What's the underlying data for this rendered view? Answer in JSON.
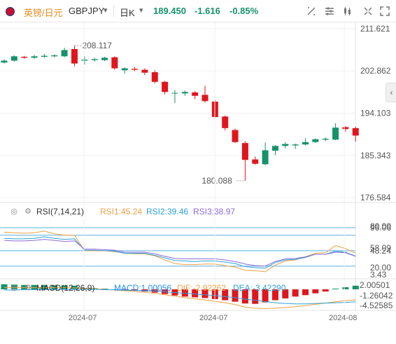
{
  "header": {
    "symbol_cn": "英镑/日元",
    "symbol_code": "GBPJPY",
    "period": "日K",
    "price": "189.450",
    "change": "-1.616",
    "change_pct": "-0.85%"
  },
  "colors": {
    "up": "#16926b",
    "down": "#e0161d",
    "rsi1": "#f0a045",
    "rsi2": "#2fa0d8",
    "rsi3": "#8a6bd8",
    "macd": "#1e90ff",
    "dif": "#f0a045",
    "dea": "#2fa0d8"
  },
  "chart_data": [
    {
      "type": "candlestick",
      "price_axis_labels": [
        "211.621",
        "202.862",
        "194.103",
        "185.343",
        "176.584"
      ],
      "ylim": [
        176.584,
        211.621
      ],
      "time_axis_labels": [
        "2024-07",
        "2024-07",
        "2024-08"
      ],
      "annotations": {
        "high_label": "208.117",
        "low_label": "180.088"
      },
      "candles": [
        {
          "o": 204.6,
          "h": 205.3,
          "c": 205.0,
          "l": 204.4
        },
        {
          "o": 205.0,
          "h": 206.1,
          "c": 205.9,
          "l": 204.8
        },
        {
          "o": 205.8,
          "h": 206.0,
          "c": 205.6,
          "l": 205.4
        },
        {
          "o": 205.6,
          "h": 206.2,
          "c": 205.9,
          "l": 205.4
        },
        {
          "o": 205.8,
          "h": 206.4,
          "c": 206.0,
          "l": 205.6
        },
        {
          "o": 205.9,
          "h": 206.3,
          "c": 206.1,
          "l": 205.7
        },
        {
          "o": 205.9,
          "h": 207.7,
          "c": 207.2,
          "l": 205.7
        },
        {
          "o": 207.4,
          "h": 208.117,
          "c": 204.4,
          "l": 203.8
        },
        {
          "o": 205.0,
          "h": 205.9,
          "c": 205.2,
          "l": 204.2
        },
        {
          "o": 205.1,
          "h": 205.6,
          "c": 205.3,
          "l": 204.8
        },
        {
          "o": 205.1,
          "h": 205.8,
          "c": 205.6,
          "l": 204.9
        },
        {
          "o": 205.7,
          "h": 205.9,
          "c": 203.4,
          "l": 203.1
        },
        {
          "o": 203.0,
          "h": 203.6,
          "c": 203.4,
          "l": 202.3
        },
        {
          "o": 203.3,
          "h": 203.7,
          "c": 203.1,
          "l": 202.8
        },
        {
          "o": 203.1,
          "h": 203.4,
          "c": 202.5,
          "l": 202.0
        },
        {
          "o": 202.6,
          "h": 203.0,
          "c": 200.6,
          "l": 200.3
        },
        {
          "o": 200.6,
          "h": 200.8,
          "c": 198.5,
          "l": 198.0
        },
        {
          "o": 198.2,
          "h": 198.9,
          "c": 198.3,
          "l": 196.2
        },
        {
          "o": 198.2,
          "h": 198.8,
          "c": 198.5,
          "l": 197.7
        },
        {
          "o": 198.4,
          "h": 198.7,
          "c": 197.7,
          "l": 197.0
        },
        {
          "o": 197.9,
          "h": 199.8,
          "c": 196.6,
          "l": 196.3
        },
        {
          "o": 196.5,
          "h": 196.9,
          "c": 193.3,
          "l": 193.0
        },
        {
          "o": 193.4,
          "h": 193.6,
          "c": 191.0,
          "l": 190.5
        },
        {
          "o": 190.6,
          "h": 190.9,
          "c": 188.1,
          "l": 187.9
        },
        {
          "o": 187.9,
          "h": 188.3,
          "c": 184.4,
          "l": 180.088
        },
        {
          "o": 184.5,
          "h": 185.1,
          "c": 183.6,
          "l": 183.4
        },
        {
          "o": 183.5,
          "h": 188.0,
          "c": 186.4,
          "l": 183.3
        },
        {
          "o": 186.3,
          "h": 187.5,
          "c": 187.3,
          "l": 185.4
        },
        {
          "o": 187.3,
          "h": 188.1,
          "c": 187.7,
          "l": 186.8
        },
        {
          "o": 187.4,
          "h": 187.8,
          "c": 187.6,
          "l": 186.7
        },
        {
          "o": 187.6,
          "h": 188.9,
          "c": 188.1,
          "l": 187.4
        },
        {
          "o": 188.1,
          "h": 188.8,
          "c": 188.7,
          "l": 187.9
        },
        {
          "o": 188.6,
          "h": 189.1,
          "c": 188.8,
          "l": 188.3
        },
        {
          "o": 188.6,
          "h": 192.0,
          "c": 191.1,
          "l": 188.5
        },
        {
          "o": 191.2,
          "h": 191.4,
          "c": 190.8,
          "l": 190.3
        },
        {
          "o": 191.0,
          "h": 191.3,
          "c": 189.45,
          "l": 188.2
        }
      ]
    },
    {
      "type": "line",
      "name": "RSI",
      "label": "RSI(7,14,21)",
      "values_text": [
        "RSI1:45.24",
        "RSI2:39.46",
        "RSI3:38.97"
      ],
      "axis_labels": [
        "96.06",
        "80.00",
        "58.09",
        "48.24",
        "20.00",
        "3.43"
      ],
      "ylim": [
        3.43,
        96.06
      ],
      "levels": [
        80,
        50,
        20
      ],
      "series": [
        {
          "name": "RSI1",
          "values": [
            86,
            85,
            84,
            85,
            88,
            83,
            80,
            80,
            50,
            50,
            50,
            48,
            45,
            44,
            44,
            40,
            32,
            25,
            23,
            23,
            24,
            24,
            21,
            18,
            12,
            11,
            9,
            22,
            30,
            32,
            38,
            45,
            46,
            60,
            54,
            45.24
          ]
        },
        {
          "name": "RSI2",
          "values": [
            74,
            73,
            73,
            74,
            77,
            74,
            72,
            73,
            51,
            51,
            50,
            49,
            45,
            45,
            45,
            41,
            36,
            31,
            30,
            29,
            30,
            30,
            28,
            25,
            19,
            17,
            16,
            27,
            32,
            33,
            37,
            43,
            43,
            49,
            47,
            39.46
          ]
        },
        {
          "name": "RSI3",
          "values": [
            70,
            69,
            69,
            70,
            72,
            70,
            68,
            69,
            53,
            53,
            52,
            51,
            47,
            47,
            47,
            44,
            39,
            35,
            34,
            34,
            34,
            34,
            32,
            29,
            24,
            21,
            20,
            29,
            34,
            35,
            38,
            43,
            43,
            47,
            46,
            38.97
          ]
        }
      ]
    },
    {
      "type": "bar",
      "name": "MACD",
      "label": "MACD(12,26,9)",
      "values_text": [
        "MACD:1.00056",
        "DIF:-2.92262",
        "DEA:-3.42290"
      ],
      "axis_labels": [
        "2.00501",
        "-1.26042",
        "-4.52585"
      ],
      "ylim": [
        -5.6,
        2.5
      ],
      "series": [
        {
          "name": "MACD",
          "values": [
            1.4,
            1.3,
            1.2,
            1.2,
            1.2,
            1.1,
            1.1,
            1.0,
            0.4,
            0.3,
            0.2,
            0.0,
            -0.2,
            -0.4,
            -0.6,
            -0.9,
            -1.3,
            -1.7,
            -2.0,
            -2.2,
            -2.4,
            -2.7,
            -3.0,
            -3.4,
            -3.9,
            -4.0,
            -3.6,
            -3.0,
            -2.5,
            -2.0,
            -1.6,
            -1.1,
            -0.6,
            0.2,
            0.6,
            1.00056
          ]
        },
        {
          "name": "DIF",
          "values": [
            0.5,
            0.5,
            0.5,
            0.5,
            0.5,
            0.5,
            0.5,
            0.4,
            0.2,
            0.1,
            0.0,
            -0.2,
            -0.4,
            -0.6,
            -0.8,
            -1.1,
            -1.5,
            -1.9,
            -2.3,
            -2.6,
            -2.9,
            -3.3,
            -3.7,
            -4.2,
            -4.9,
            -5.2,
            -5.3,
            -5.2,
            -5.0,
            -4.8,
            -4.5,
            -4.1,
            -3.8,
            -3.4,
            -3.1,
            -2.92262
          ]
        },
        {
          "name": "DEA",
          "values": [
            -0.2,
            -0.2,
            -0.1,
            -0.1,
            -0.1,
            0.0,
            0.0,
            0.0,
            0.0,
            0.0,
            -0.1,
            -0.1,
            -0.2,
            -0.3,
            -0.4,
            -0.5,
            -0.7,
            -0.9,
            -1.1,
            -1.3,
            -1.5,
            -1.7,
            -2.0,
            -2.3,
            -2.7,
            -3.0,
            -3.4,
            -3.7,
            -3.9,
            -4.0,
            -4.0,
            -3.9,
            -3.8,
            -3.7,
            -3.6,
            -3.4229
          ]
        }
      ]
    }
  ]
}
